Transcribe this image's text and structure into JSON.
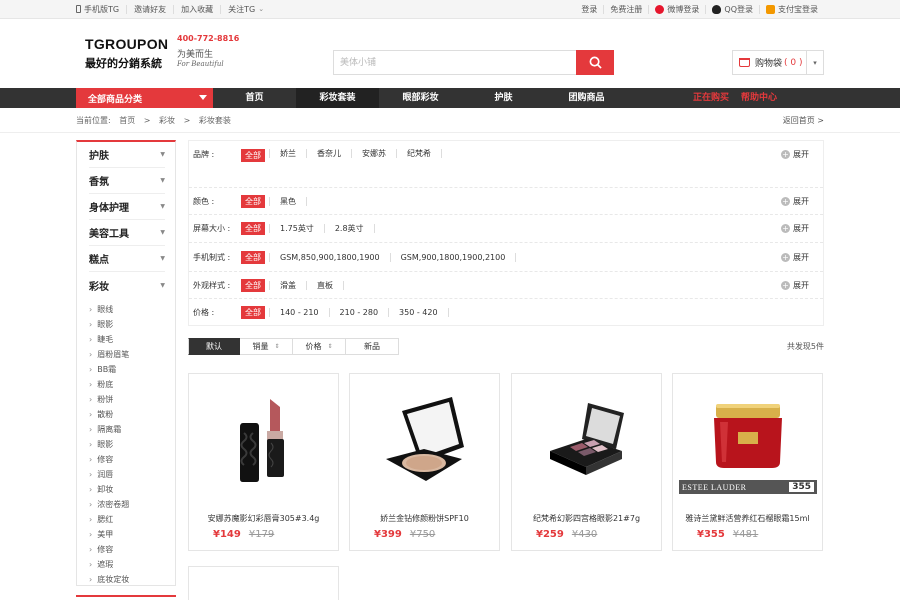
{
  "topbar": {
    "left": [
      {
        "label": "手机版TG"
      },
      {
        "label": "邀请好友"
      },
      {
        "label": "加入收藏"
      },
      {
        "label": "关注TG"
      }
    ],
    "right": [
      {
        "label": "登录"
      },
      {
        "label": "免费注册"
      },
      {
        "label": "微博登录"
      },
      {
        "label": "QQ登录"
      },
      {
        "label": "支付宝登录"
      }
    ]
  },
  "header": {
    "brand": "TGROUPON",
    "slogan": "最好的分銷系統",
    "phone": "400-772-8816",
    "tagline_cn": "为美而生",
    "tagline_en": "For Beautiful",
    "search_placeholder": "美体小铺",
    "cart_label": "购物袋",
    "cart_count": "( 0 )"
  },
  "nav": {
    "category_label": "全部商品分类",
    "links": [
      "首页",
      "彩妆套装",
      "眼部彩妆",
      "护肤",
      "团购商品"
    ],
    "active_index": 1,
    "right_links": [
      "正在购买",
      "帮助中心"
    ]
  },
  "breadcrumb": {
    "prefix": "当前位置:",
    "items": [
      "首页",
      ">",
      "彩妆",
      ">",
      "彩妆套装"
    ],
    "back": "返回首页 >"
  },
  "sidebar": {
    "categories": [
      "护肤",
      "香氛",
      "身体护理",
      "美容工具",
      "糕点",
      "彩妆"
    ],
    "subitems": [
      "眼线",
      "眼影",
      "睫毛",
      "眉粉眉笔",
      "BB霜",
      "粉底",
      "粉饼",
      "散粉",
      "隔离霜",
      "眼影",
      "修容",
      "润唇",
      "卸妆",
      "浓密卷翘",
      "腮红",
      "美甲",
      "修容",
      "遮瑕",
      "底妆定妆"
    ]
  },
  "filter": {
    "all_label": "全部",
    "expand_label": "展开",
    "rows": [
      {
        "label": "品牌 :",
        "options": [
          "娇兰",
          "香奈儿",
          "安娜苏",
          "纪梵希"
        ],
        "expand": true
      },
      {
        "label": "颜色 :",
        "options": [
          "黑色"
        ],
        "expand": true
      },
      {
        "label": "屏幕大小 :",
        "options": [
          "1.75英寸",
          "2.8英寸"
        ],
        "expand": true
      },
      {
        "label": "手机制式 :",
        "options": [
          "GSM,850,900,1800,1900",
          "GSM,900,1800,1900,2100"
        ],
        "expand": true
      },
      {
        "label": "外观样式 :",
        "options": [
          "滑盖",
          "直板"
        ],
        "expand": true
      },
      {
        "label": "价格 :",
        "options": [
          "140 - 210",
          "210 - 280",
          "350 - 420"
        ],
        "expand": false
      }
    ]
  },
  "sort": {
    "buttons": [
      "默认",
      "销量",
      "价格",
      "新品"
    ],
    "found": "共发现5件"
  },
  "products": [
    {
      "name": "安娜苏魔影幻彩唇膏305#3.4g",
      "price": "¥149",
      "old_price": "¥179"
    },
    {
      "name": "娇兰金钻修颜粉饼SPF10",
      "price": "¥399",
      "old_price": "¥750"
    },
    {
      "name": "纪梵希幻影四宫格眼影21#7g",
      "price": "¥259",
      "old_price": "¥430"
    },
    {
      "name": "雅诗兰黛鲜活营养红石榴眼霜15ml",
      "price": "¥355",
      "old_price": "¥481",
      "badge_brand": "ESTEE LAUDER",
      "badge_price": "355"
    }
  ],
  "colors": {
    "accent": "#e4393c",
    "nav_bg": "#333333"
  }
}
